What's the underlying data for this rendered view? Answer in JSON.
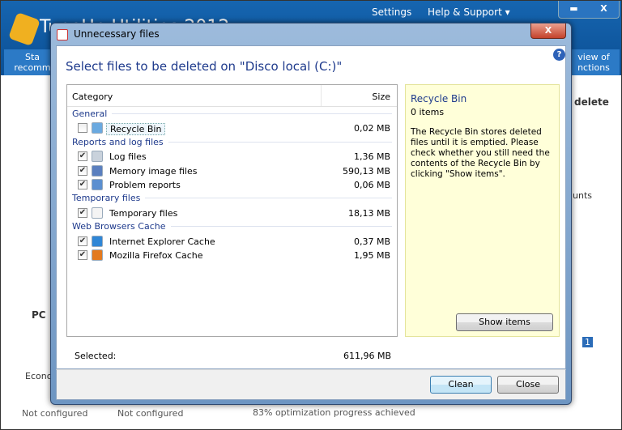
{
  "app": {
    "title": "TuneUp Utilities 2012",
    "nav": {
      "settings": "Settings",
      "help": "Help & Support ▾"
    },
    "window_buttons": {
      "minimize": "▬",
      "close": "X"
    },
    "tabs": {
      "left": "Sta\nrecomm",
      "right": "view of\nnctions"
    },
    "partial": {
      "delete": "delete",
      "pc": "PC ",
      "econ": "Econo",
      "accounts": "unts",
      "page": "1"
    },
    "status": [
      "Not configured",
      "Not configured",
      "83% optimization progress achieved"
    ]
  },
  "dialog": {
    "title": "Unnecessary files",
    "close": "X",
    "heading": "Select files to be deleted on \"Disco local (C:)\"",
    "help": "?",
    "columns": {
      "category": "Category",
      "size": "Size"
    },
    "groups": [
      {
        "label": "General",
        "items": [
          {
            "label": "Recycle Bin",
            "size": "0,02 MB",
            "checked": false,
            "icon": "recycle-bin-icon",
            "color": "#6aa9e0"
          }
        ]
      },
      {
        "label": "Reports and log files",
        "items": [
          {
            "label": "Log files",
            "size": "1,36 MB",
            "checked": true,
            "icon": "log-file-icon",
            "color": "#c9d2dc"
          },
          {
            "label": "Memory image files",
            "size": "590,13 MB",
            "checked": true,
            "icon": "memory-image-icon",
            "color": "#5a7fbf"
          },
          {
            "label": "Problem reports",
            "size": "0,06 MB",
            "checked": true,
            "icon": "problem-report-icon",
            "color": "#5b8fd0"
          }
        ]
      },
      {
        "label": "Temporary files",
        "items": [
          {
            "label": "Temporary files",
            "size": "18,13 MB",
            "checked": true,
            "icon": "file-icon",
            "color": "#f4f4f4"
          }
        ]
      },
      {
        "label": "Web Browsers Cache",
        "items": [
          {
            "label": "Internet Explorer Cache",
            "size": "0,37 MB",
            "checked": true,
            "icon": "internet-explorer-icon",
            "color": "#2f86d6"
          },
          {
            "label": "Mozilla Firefox Cache",
            "size": "1,95 MB",
            "checked": true,
            "icon": "firefox-icon",
            "color": "#e37a1f"
          }
        ]
      }
    ],
    "info": {
      "title": "Recycle Bin",
      "count": "0 items",
      "description": "The Recycle Bin stores deleted files until it is emptied. Please check whether you still need the contents of the Recycle Bin by clicking \"Show items\".",
      "show_items": "Show items"
    },
    "selected_label": "Selected:",
    "selected_size": "611,96 MB",
    "buttons": {
      "clean": "Clean",
      "close": "Close"
    }
  }
}
